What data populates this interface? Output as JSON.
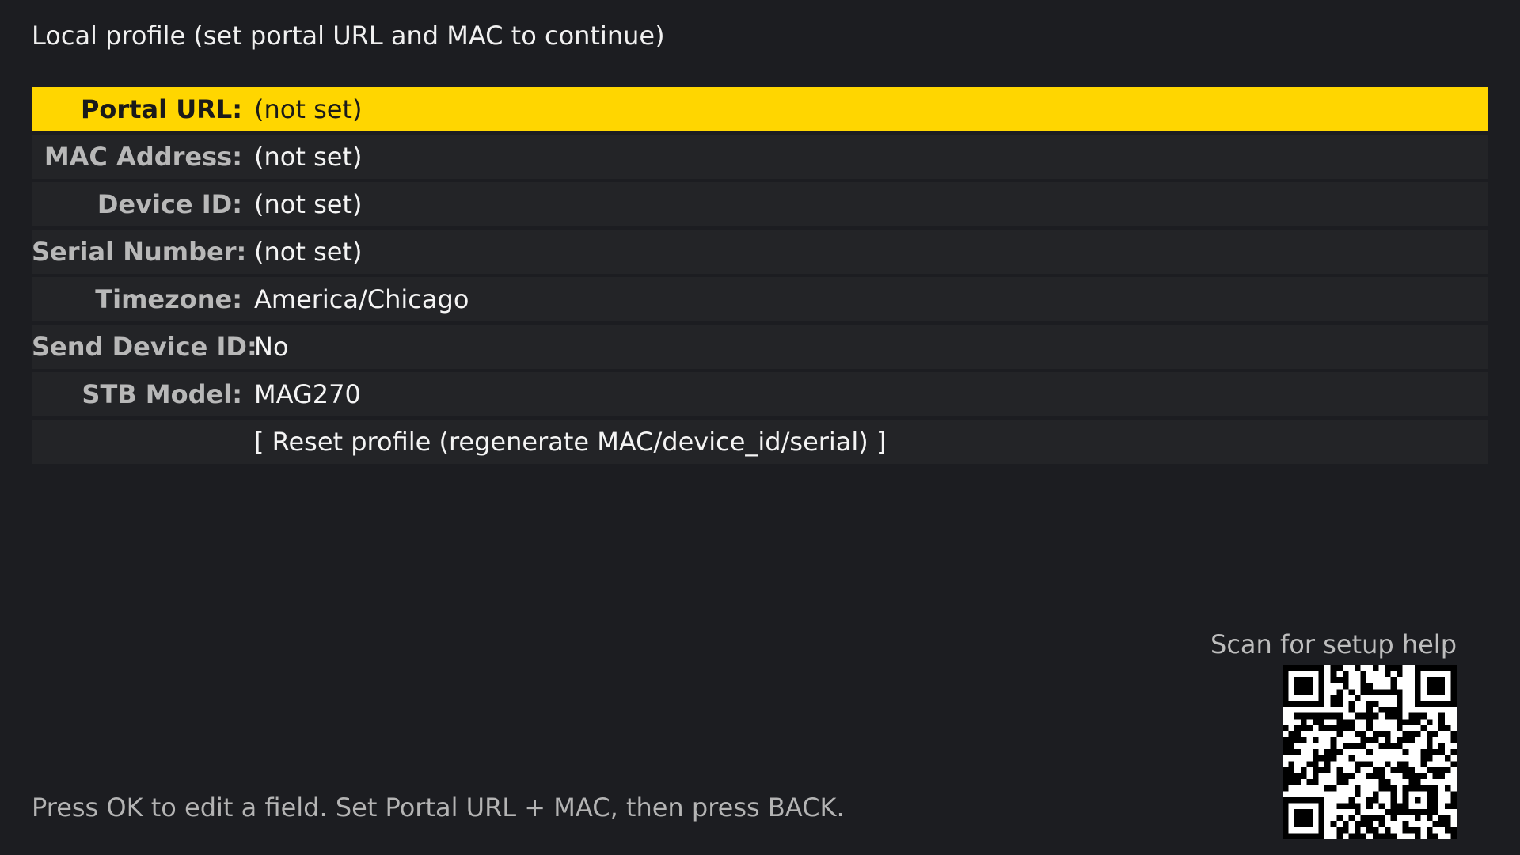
{
  "header": {
    "title": "Local profile (set portal URL and MAC to continue)"
  },
  "settings": {
    "rows": [
      {
        "label": "Portal URL:",
        "value": "(not set)",
        "selected": true
      },
      {
        "label": "MAC Address:",
        "value": "(not set)",
        "selected": false
      },
      {
        "label": "Device ID:",
        "value": "(not set)",
        "selected": false
      },
      {
        "label": "Serial Number:",
        "value": "(not set)",
        "selected": false
      },
      {
        "label": "Timezone:",
        "value": "America/Chicago",
        "selected": false
      },
      {
        "label": "Send Device ID:",
        "value": "No",
        "selected": false
      },
      {
        "label": "STB Model:",
        "value": "MAG270",
        "selected": false
      },
      {
        "label": "",
        "value": "[ Reset profile (regenerate MAC/device_id/serial) ]",
        "selected": false
      }
    ]
  },
  "help": {
    "qr_caption": "Scan for setup help",
    "qr_icon": "qr-code-icon"
  },
  "footer": {
    "hint": "Press OK to edit a field. Set Portal URL + MAC, then press BACK."
  },
  "colors": {
    "background": "#1c1d21",
    "row_background": "#232427",
    "selection_accent": "#ffd600"
  }
}
